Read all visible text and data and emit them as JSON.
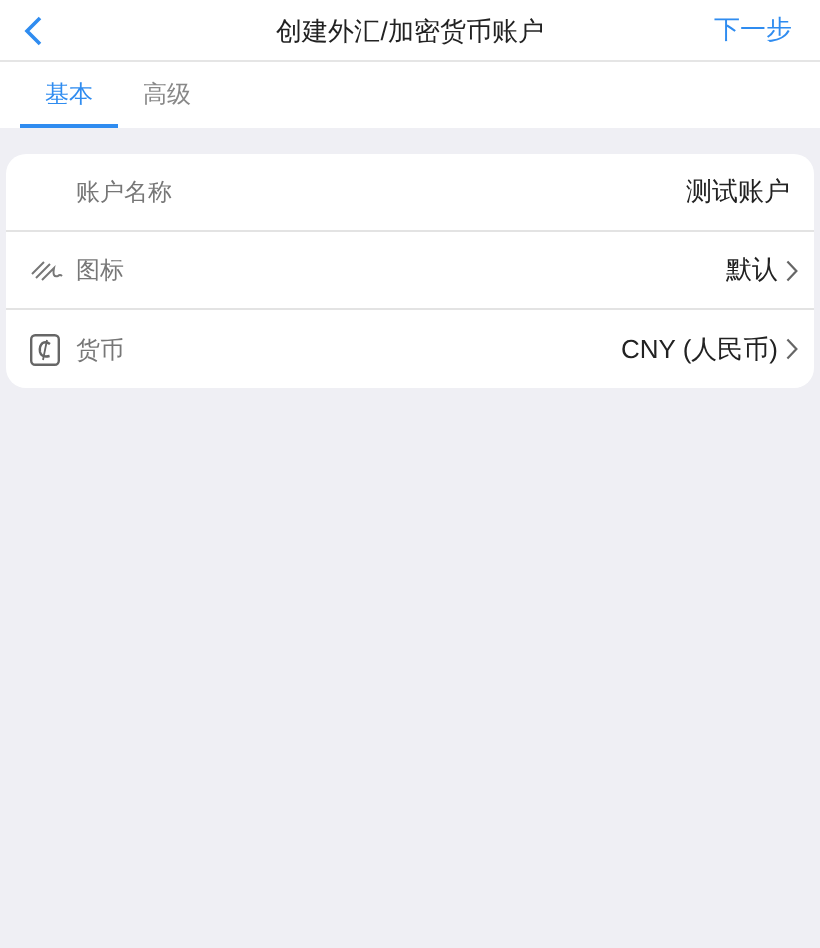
{
  "nav": {
    "title": "创建外汇/加密货币账户",
    "action": "下一步"
  },
  "tabs": [
    {
      "label": "基本",
      "selected": true
    },
    {
      "label": "高级",
      "selected": false
    }
  ],
  "rows": [
    {
      "kind": "plain",
      "label": "账户名称",
      "value": "测试账户",
      "chevron": false
    },
    {
      "kind": "signature",
      "label": "图标",
      "value": "默认",
      "chevron": true
    },
    {
      "kind": "currency",
      "label": "货币",
      "value": "CNY (人民币)",
      "chevron": true
    }
  ]
}
